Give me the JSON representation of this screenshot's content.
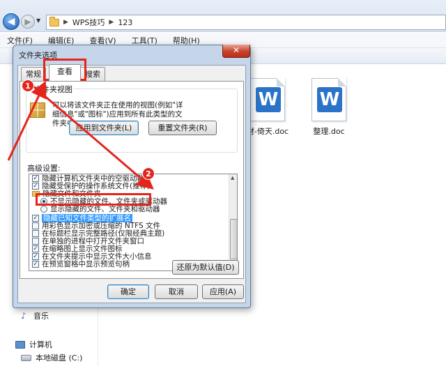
{
  "explorer": {
    "breadcrumb": [
      "WPS技巧",
      "123"
    ],
    "menu": [
      "文件(F)",
      "编辑(E)",
      "查看(V)",
      "工具(T)",
      "帮助(H)"
    ],
    "files": [
      {
        "label": "材-倚天.doc",
        "icon": "word-doc-icon"
      },
      {
        "label": "整理.doc",
        "icon": "word-doc-icon"
      }
    ],
    "navtree": {
      "music": "音乐",
      "computer": "计算机",
      "local_disk": "本地磁盘 (C:)"
    }
  },
  "dialog": {
    "title": "文件夹选项",
    "close_glyph": "✕",
    "tabs": [
      "常规",
      "查看",
      "搜索"
    ],
    "active_tab": "查看",
    "folder_views": {
      "group_label": "文件夹视图",
      "description": "可以将该文件夹正在使用的视图(例如\"详细信息\"或\"图标\")应用到所有此类型的文件夹中",
      "apply_button": "应用到文件夹(L)",
      "reset_button": "重置文件夹(R)"
    },
    "advanced": {
      "label": "高级设置:",
      "rows": [
        {
          "type": "checkbox",
          "checked": true,
          "text": "隐藏计算机文件夹中的空驱动器"
        },
        {
          "type": "checkbox",
          "checked": true,
          "text": "隐藏受保护的操作系统文件(推荐)"
        },
        {
          "type": "folder",
          "text": "隐藏文件和文件夹"
        },
        {
          "type": "radio",
          "checked": true,
          "text": "不显示隐藏的文件、文件夹或驱动器"
        },
        {
          "type": "radio",
          "checked": false,
          "text": "显示隐藏的文件、文件夹和驱动器"
        },
        {
          "type": "checkbox",
          "checked": true,
          "text": "隐藏已知文件类型的扩展名",
          "selected": true
        },
        {
          "type": "checkbox",
          "checked": false,
          "text": "用彩色显示加密或压缩的 NTFS 文件"
        },
        {
          "type": "checkbox",
          "checked": false,
          "text": "在标题栏显示完整路径(仅限经典主题)"
        },
        {
          "type": "checkbox",
          "checked": false,
          "text": "在单独的进程中打开文件夹窗口"
        },
        {
          "type": "checkbox",
          "checked": true,
          "text": "在缩略图上显示文件图标"
        },
        {
          "type": "checkbox",
          "checked": true,
          "text": "在文件夹提示中显示文件大小信息"
        },
        {
          "type": "checkbox",
          "checked": true,
          "text": "在预览窗格中显示预览句柄"
        }
      ],
      "restore_button": "还原为默认值(D)"
    },
    "footer": {
      "ok": "确定",
      "cancel": "取消",
      "apply": "应用(A)"
    }
  },
  "annotations": {
    "badge_1": "1",
    "badge_2": "2",
    "color": "#e5241b"
  }
}
